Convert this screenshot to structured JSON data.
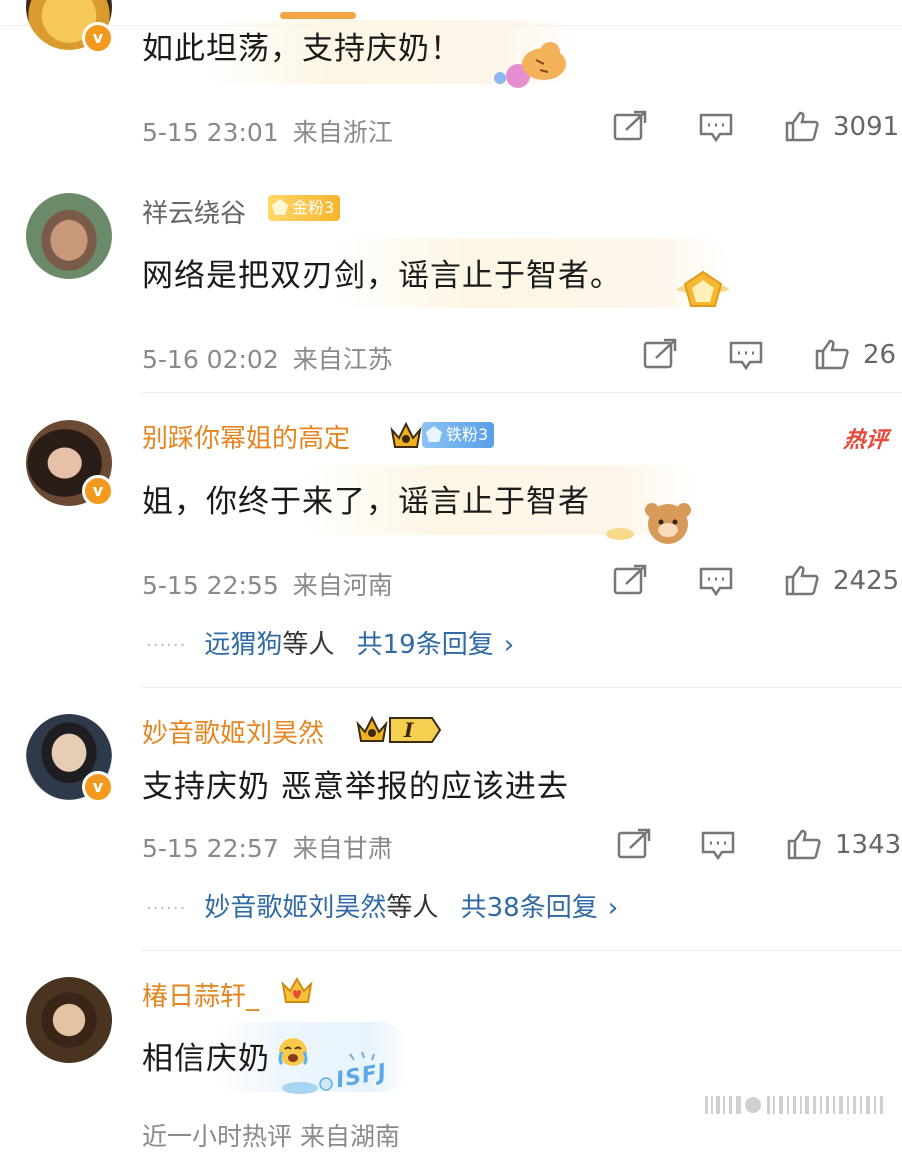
{
  "comments": [
    {
      "username": "",
      "text": "如此坦荡，支持庆奶！",
      "time": "5-15 23:01",
      "location": "来自浙江",
      "likes": "3091"
    },
    {
      "username": "祥云绕谷",
      "fan_badge": "金粉3",
      "text": "网络是把双刃剑，谣言止于智者。",
      "time": "5-16 02:02",
      "location": "来自江苏",
      "likes": "26"
    },
    {
      "username": "别踩你幂姐的高定",
      "fan_badge": "铁粉3",
      "hot_tag": "热评",
      "text": "姐，你终于来了，谣言止于智者",
      "time": "5-15 22:55",
      "location": "来自河南",
      "likes": "2425",
      "replies": {
        "dots": "······",
        "name": "远猬狗",
        "suffix": "等人",
        "count_text": "共19条回复",
        "chevron": "›"
      }
    },
    {
      "username": "妙音歌姬刘昊然",
      "level_badge": "I",
      "text": "支持庆奶 恶意举报的应该进去",
      "time": "5-15 22:57",
      "location": "来自甘肃",
      "likes": "1343",
      "replies": {
        "dots": "······",
        "name": "妙音歌姬刘昊然",
        "suffix": "等人",
        "count_text": "共38条回复",
        "chevron": "›"
      }
    },
    {
      "username": "椿日蒜轩_",
      "text": "相信庆奶",
      "bottom_meta": "近一小时热评 来自湖南"
    }
  ],
  "verified_mark": "v",
  "sticker_text": "ISFJ",
  "icons": [
    "share-icon",
    "comment-icon",
    "like-icon",
    "chevron-right-icon",
    "crown-icon"
  ],
  "colors": {
    "username_orange": "#e5851f",
    "link_blue": "#2f6aa6",
    "hot_red": "#e8473a",
    "verified_orange": "#f39a1e"
  }
}
